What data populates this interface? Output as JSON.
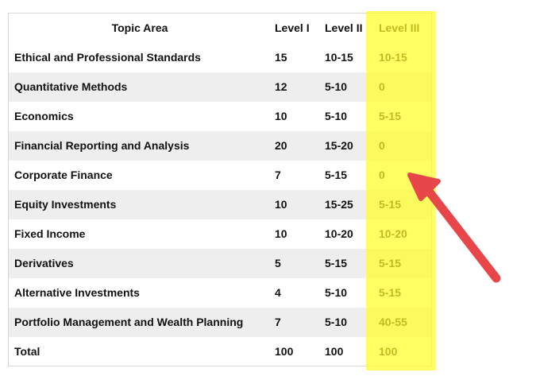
{
  "table": {
    "headers": {
      "topic": "Topic Area",
      "level1": "Level I",
      "level2": "Level II",
      "level3": "Level III"
    },
    "rows": [
      {
        "topic": "Ethical and Professional Standards",
        "level1": "15",
        "level2": "10-15",
        "level3": "10-15"
      },
      {
        "topic": "Quantitative Methods",
        "level1": "12",
        "level2": "5-10",
        "level3": "0"
      },
      {
        "topic": "Economics",
        "level1": "10",
        "level2": "5-10",
        "level3": "5-15"
      },
      {
        "topic": "Financial Reporting and Analysis",
        "level1": "20",
        "level2": "15-20",
        "level3": "0"
      },
      {
        "topic": "Corporate Finance",
        "level1": "7",
        "level2": "5-15",
        "level3": "0"
      },
      {
        "topic": "Equity Investments",
        "level1": "10",
        "level2": "15-25",
        "level3": "5-15"
      },
      {
        "topic": "Fixed Income",
        "level1": "10",
        "level2": "10-20",
        "level3": "10-20"
      },
      {
        "topic": "Derivatives",
        "level1": "5",
        "level2": "5-15",
        "level3": "5-15"
      },
      {
        "topic": "Alternative Investments",
        "level1": "4",
        "level2": "5-10",
        "level3": "5-15"
      },
      {
        "topic": "Portfolio Management and Wealth Planning",
        "level1": "7",
        "level2": "5-10",
        "level3": "40-55"
      },
      {
        "topic": "Total",
        "level1": "100",
        "level2": "100",
        "level3": "100"
      }
    ]
  },
  "colors": {
    "highlight": "#ffff28",
    "arrow": "#e8474a",
    "row_shade": "#eeeeee"
  }
}
